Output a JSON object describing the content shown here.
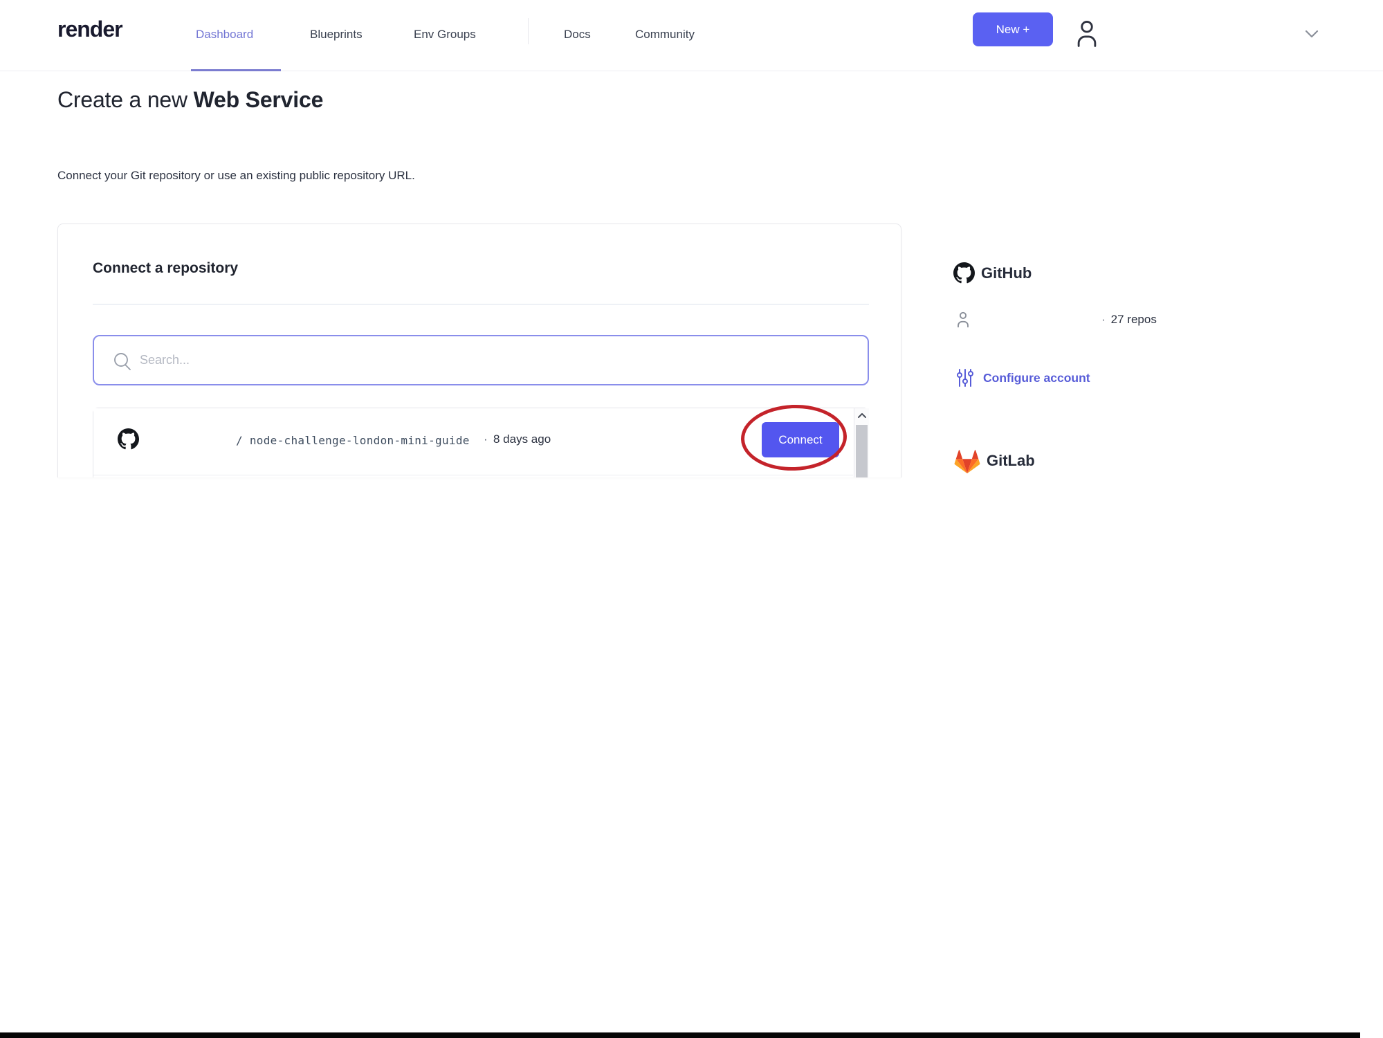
{
  "brand": {
    "logo": "render"
  },
  "nav": {
    "links": [
      {
        "label": "Dashboard"
      },
      {
        "label": "Blueprints"
      },
      {
        "label": "Env Groups"
      },
      {
        "label": "Docs"
      },
      {
        "label": "Community"
      }
    ],
    "new_button": "New +"
  },
  "page": {
    "title_regular": "Create a new ",
    "title_bold": "Web Service",
    "subtitle": "Connect your Git repository or use an existing public repository URL."
  },
  "card": {
    "heading": "Connect a repository",
    "search_placeholder": "Search...",
    "repo": {
      "owner": "",
      "path": "/ node-challenge-london-mini-guide",
      "dot": "·",
      "updated": "8 days ago",
      "connect_label": "Connect"
    }
  },
  "sidebar": {
    "github": {
      "title": "GitHub",
      "username": "",
      "dot": "·",
      "repos_count": "27 repos",
      "configure_label": "Configure account"
    },
    "gitlab": {
      "title": "GitLab"
    }
  },
  "colors": {
    "accent": "#5a61f2",
    "connect_button": "#5356ef",
    "active_link": "#7376d4",
    "annotation_red": "#c4232a"
  }
}
